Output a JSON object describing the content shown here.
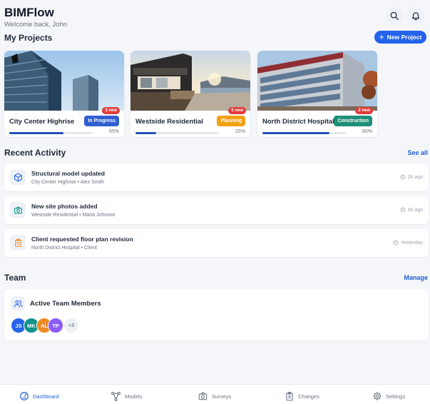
{
  "app": {
    "title": "BIMFlow",
    "welcome": "Welcome back, John"
  },
  "projects": {
    "title": "My Projects",
    "new_label": "New Project",
    "items": [
      {
        "name": "City Center Highrise",
        "new_count": "3 new",
        "status": "In Progress",
        "status_color": "#2f5fd0",
        "progress": 65,
        "progress_label": "65%"
      },
      {
        "name": "Westside Residential",
        "new_count": "5 new",
        "status": "Planning",
        "status_color": "#f2a114",
        "progress": 25,
        "progress_label": "25%"
      },
      {
        "name": "North District Hospital",
        "new_count": "2 new",
        "status": "Construction",
        "status_color": "#1f8f7a",
        "progress": 80,
        "progress_label": "80%"
      }
    ]
  },
  "activity": {
    "title": "Recent Activity",
    "see_all": "See all",
    "items": [
      {
        "title": "Structural model updated",
        "sub": "City Center Highrise • Alex Smith",
        "time": "2h ago",
        "icon": "cube-icon"
      },
      {
        "title": "New site photos added",
        "sub": "Westside Residential • Maria Johnson",
        "time": "4h ago",
        "icon": "camera-icon"
      },
      {
        "title": "Client requested floor plan revision",
        "sub": "North District Hospital • Client",
        "time": "Yesterday",
        "icon": "clipboard-icon"
      }
    ]
  },
  "team": {
    "title": "Team",
    "manage": "Manage",
    "card_title": "Active Team Members",
    "members": [
      {
        "initials": "JS",
        "color": "#2563eb"
      },
      {
        "initials": "MK",
        "color": "#0f9488"
      },
      {
        "initials": "AL",
        "color": "#f08a24"
      },
      {
        "initials": "TP",
        "color": "#8b5cf6"
      }
    ],
    "more": "+3"
  },
  "nav": {
    "dashboard": "Dashboard",
    "models": "Models",
    "surveys": "Surveys",
    "changes": "Changes",
    "settings": "Settings"
  },
  "colors": {
    "accent": "#2563eb",
    "badge_red": "#e23b3b"
  }
}
